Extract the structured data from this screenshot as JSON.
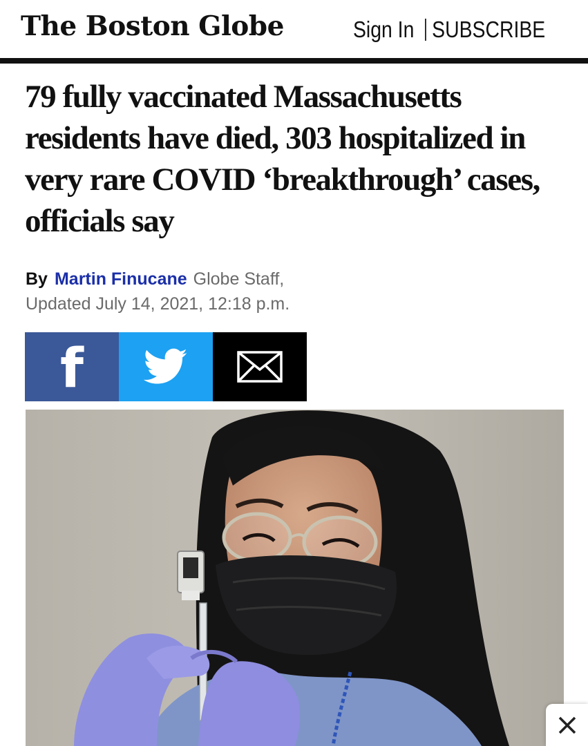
{
  "masthead": {
    "logo_text": "The Boston Globe",
    "sign_in": "Sign In",
    "subscribe": "SUBSCRIBE"
  },
  "article": {
    "headline": "79 fully vaccinated Massachusetts residents have died, 303 hospitalized in very rare COVID ‘breakthrough’ cases, officials say",
    "by_label": "By",
    "author": "Martin Finucane",
    "author_role": "Globe Staff,",
    "updated": "Updated July 14, 2021, 12:18 p.m."
  },
  "share": {
    "facebook_glyph": "f",
    "icons": [
      "facebook-icon",
      "twitter-icon",
      "email-icon"
    ],
    "colors": {
      "facebook": "#3b5998",
      "twitter": "#1da1f2",
      "email": "#000000"
    }
  },
  "colors": {
    "author_link": "#1b2fa8",
    "meta_gray": "#6a6a6a"
  },
  "photo": {
    "subject": "health worker in black mask and glasses drawing vaccine from a vial"
  },
  "overlay": {
    "close_icon": "close-icon"
  }
}
